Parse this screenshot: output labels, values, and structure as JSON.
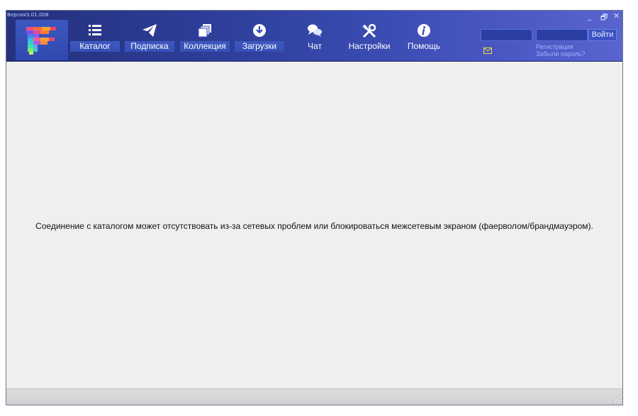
{
  "window": {
    "version": "Версия3.01.008",
    "controls": {
      "minimize": "_",
      "restore": "🗗",
      "close": "✕"
    }
  },
  "nav": {
    "items": [
      {
        "label": "Каталог",
        "icon": "list-icon"
      },
      {
        "label": "Подписка",
        "icon": "paper-plane-icon"
      },
      {
        "label": "Коллекция",
        "icon": "collection-icon"
      },
      {
        "label": "Загрузки",
        "icon": "download-icon"
      },
      {
        "label": "Чат",
        "icon": "chat-icon"
      },
      {
        "label": "Настройки",
        "icon": "tools-icon"
      },
      {
        "label": "Помощь",
        "icon": "info-icon"
      }
    ]
  },
  "login": {
    "login_value": "",
    "password_value": "",
    "button_label": "Войти",
    "register_link": "Регистрация",
    "forgot_link": "Забыли пароль?",
    "mail_icon": "envelope-icon"
  },
  "content": {
    "message": "Соединение с каталогом может отсутствовать из-за сетевых проблем или блокироваться межсетевым экраном (фаерволом/брандмауэром)."
  },
  "colors": {
    "header_start": "#25317c",
    "header_end": "#5964cf",
    "accent_icon": "#ffffff",
    "mail_icon": "#f2d84a"
  }
}
